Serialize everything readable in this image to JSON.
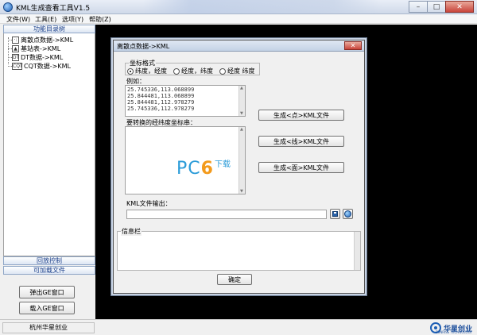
{
  "window": {
    "title": "KML生成查看工具V1.5",
    "minimize": "–",
    "maximize": "□",
    "close": "✕"
  },
  "menu": [
    "文件(W)",
    "工具(E)",
    "选项(Y)",
    "帮助(Z)"
  ],
  "left_panel": {
    "header": "功能目录树",
    "tree": [
      {
        "icon": "·:",
        "label": "离散点数据->KML"
      },
      {
        "icon": "▲",
        "label": "基站表->KML"
      },
      {
        "icon": "DT",
        "label": "DT数据->KML"
      },
      {
        "icon": "CQT",
        "label": "CQT数据->KML"
      }
    ],
    "playback_header": "回放控制",
    "loadable_header": "可加载文件",
    "buttons": {
      "popup_ge": "弹出GE窗口",
      "load_ge": "载入GE窗口"
    }
  },
  "status": {
    "company": "杭州华星创业",
    "brand": "华星创业",
    "brand_sub": "SUNRISE TECHNOLOGY"
  },
  "dialog": {
    "title": "离散点数据->KML",
    "close": "✕",
    "coord_format": {
      "label": "坐标格式",
      "options": [
        {
          "label": "纬度，经度",
          "selected": true
        },
        {
          "label": "经度，纬度",
          "selected": false
        },
        {
          "label": "经度 纬度",
          "selected": false
        }
      ]
    },
    "example": {
      "label": "例如：",
      "lines": [
        "25.745336,113.068899",
        "25.844481,113.068899",
        "25.844481,112.978279",
        "25.745336,112.978279"
      ]
    },
    "input_label": "要转换的经纬度坐标串：",
    "buttons": {
      "point": "生成<点>KML文件",
      "line": "生成<线>KML文件",
      "polygon": "生成<面>KML文件",
      "ok": "确定"
    },
    "kml_output_label": "KML文件输出：",
    "kml_output_value": "",
    "info_label": "信息栏"
  },
  "watermark": {
    "pc": "PC",
    "six": "6",
    "sub": "下载"
  }
}
